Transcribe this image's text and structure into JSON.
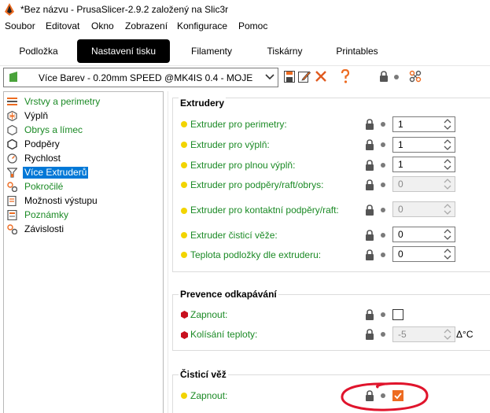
{
  "window": {
    "title": "*Bez názvu - PrusaSlicer-2.9.2 založený na Slic3r"
  },
  "menu": [
    "Soubor",
    "Editovat",
    "Okno",
    "Zobrazení",
    "Konfigurace",
    "Pomoc"
  ],
  "tabs": [
    {
      "label": "Podložka",
      "active": false
    },
    {
      "label": "Nastavení tisku",
      "active": true
    },
    {
      "label": "Filamenty",
      "active": false
    },
    {
      "label": "Tiskárny",
      "active": false
    },
    {
      "label": "Printables",
      "active": false
    }
  ],
  "preset": {
    "selected": "Více Barev - 0.20mm SPEED @MK4IS 0.4 - MOJE"
  },
  "sidebar": {
    "items": [
      {
        "label": "Vrstvy a perimetry",
        "color": "green"
      },
      {
        "label": "Výplň",
        "color": "black"
      },
      {
        "label": "Obrys a límec",
        "color": "green"
      },
      {
        "label": "Podpěry",
        "color": "black"
      },
      {
        "label": "Rychlost",
        "color": "black"
      },
      {
        "label": "Více Extruderů",
        "color": "black",
        "selected": true
      },
      {
        "label": "Pokročilé",
        "color": "green"
      },
      {
        "label": "Možnosti výstupu",
        "color": "black"
      },
      {
        "label": "Poznámky",
        "color": "green"
      },
      {
        "label": "Závislosti",
        "color": "black"
      }
    ]
  },
  "groups": {
    "extruders": {
      "title": "Extrudery",
      "rows": [
        {
          "label": "Extruder pro perimetry:",
          "value": "1",
          "disabled": false
        },
        {
          "label": "Extruder pro výplň:",
          "value": "1",
          "disabled": false
        },
        {
          "label": "Extruder pro plnou výplň:",
          "value": "1",
          "disabled": false
        },
        {
          "label": "Extruder pro podpěry/raft/obrys:",
          "value": "0",
          "disabled": true
        },
        {
          "label": "Extruder pro kontaktní podpěry/raft:",
          "value": "0",
          "disabled": true
        },
        {
          "label": "Extruder čisticí věže:",
          "value": "0",
          "disabled": false
        },
        {
          "label": "Teplota podložky dle extruderu:",
          "value": "0",
          "disabled": false
        }
      ]
    },
    "ooze": {
      "title": "Prevence odkapávání",
      "enable_label": "Zapnout:",
      "enable_checked": false,
      "temp_label": "Kolísání teploty:",
      "temp_value": "-5",
      "temp_unit": "Δ°C"
    },
    "wipe_tower": {
      "title": "Čisticí věž",
      "enable_label": "Zapnout:",
      "enable_checked": true
    }
  },
  "colors": {
    "accent": "#ed6b21",
    "selection": "#0078d7",
    "green_label": "#1b8a25",
    "simple_mode_bullet": "#f2d400",
    "expert_mode_hex": "#c8101e",
    "annotation_circle": "#e0142c"
  },
  "icons": {
    "save": "floppy-icon",
    "rename": "pencil-icon",
    "delete": "red-x-icon",
    "help": "question-icon",
    "lock": "lock-icon",
    "compare": "compare-icon"
  }
}
